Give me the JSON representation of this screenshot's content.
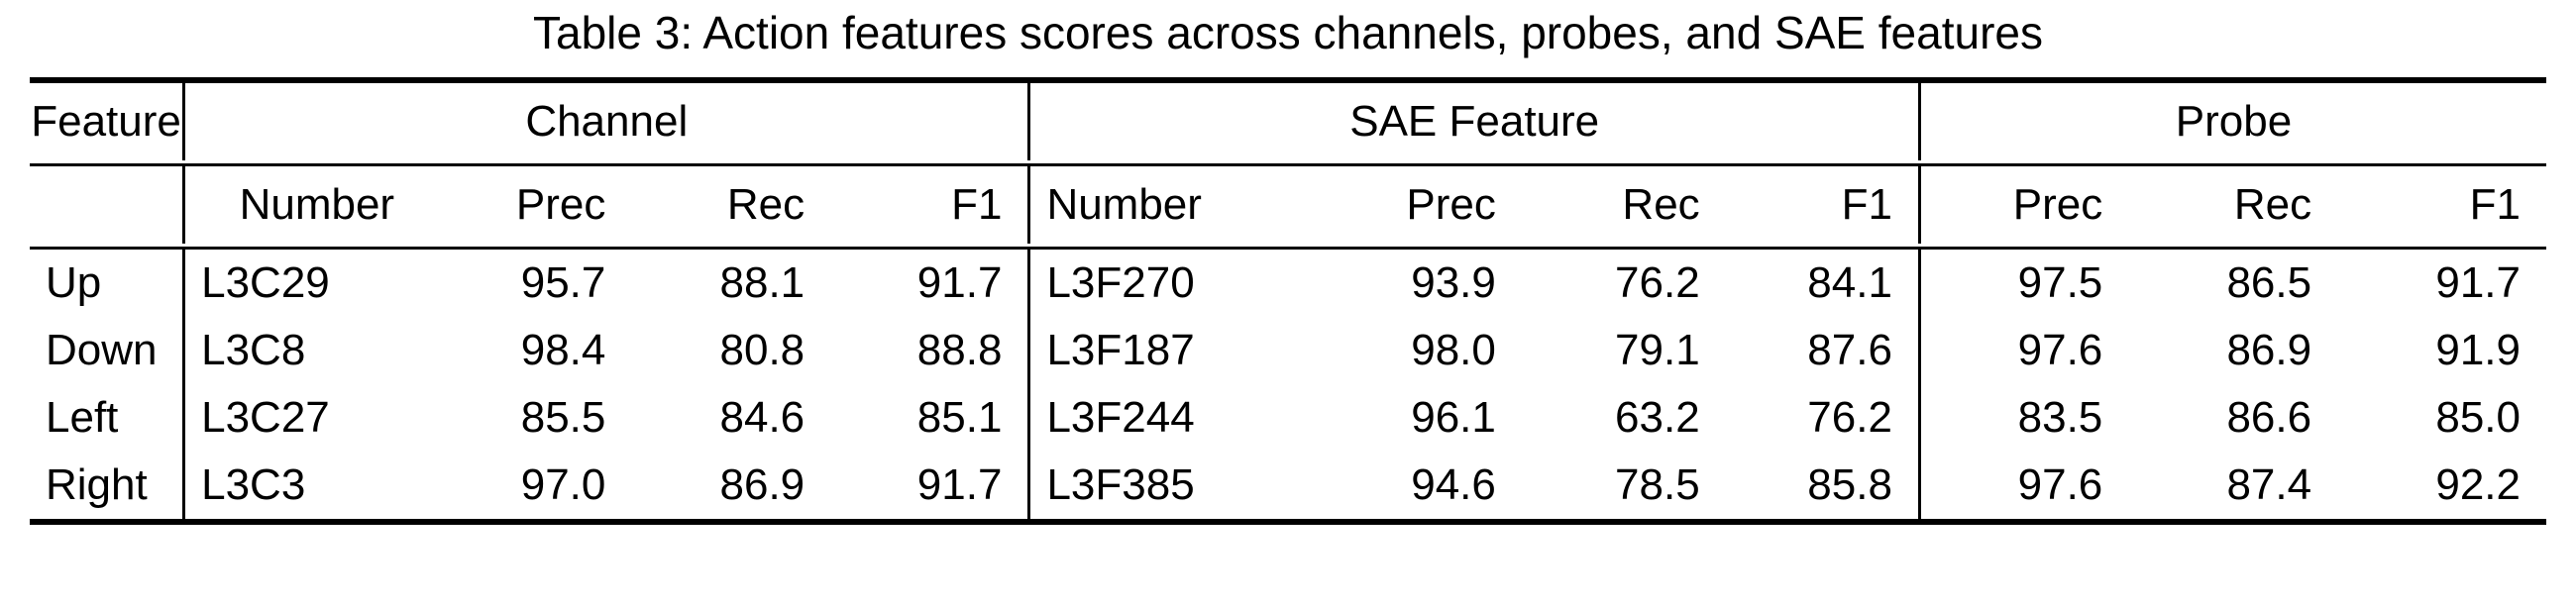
{
  "caption": "Table 3: Action features scores across channels, probes, and SAE features",
  "group_headers": {
    "feature": "Feature",
    "channel": "Channel",
    "sae_feature": "SAE Feature",
    "probe": "Probe"
  },
  "sub_headers": {
    "channel": [
      "Number",
      "Prec",
      "Rec",
      "F1"
    ],
    "sae": [
      "Number",
      "Prec",
      "Rec",
      "F1"
    ],
    "probe": [
      "Prec",
      "Rec",
      "F1"
    ]
  },
  "chart_data": {
    "type": "table",
    "title": "Table 3: Action features scores across channels, probes, and SAE features",
    "columns": [
      "Feature",
      "Channel Number",
      "Channel Prec",
      "Channel Rec",
      "Channel F1",
      "SAE Feature Number",
      "SAE Feature Prec",
      "SAE Feature Rec",
      "SAE Feature F1",
      "Probe Prec",
      "Probe Rec",
      "Probe F1"
    ],
    "categories": [
      "Up",
      "Down",
      "Left",
      "Right"
    ],
    "series": [
      {
        "name": "Channel Prec",
        "values": [
          95.7,
          98.4,
          85.5,
          97.0
        ]
      },
      {
        "name": "Channel Rec",
        "values": [
          88.1,
          80.8,
          84.6,
          86.9
        ]
      },
      {
        "name": "Channel F1",
        "values": [
          91.7,
          88.8,
          85.1,
          91.7
        ]
      },
      {
        "name": "SAE Feature Prec",
        "values": [
          93.9,
          98.0,
          96.1,
          94.6
        ]
      },
      {
        "name": "SAE Feature Rec",
        "values": [
          76.2,
          79.1,
          63.2,
          78.5
        ]
      },
      {
        "name": "SAE Feature F1",
        "values": [
          84.1,
          87.6,
          76.2,
          85.8
        ]
      },
      {
        "name": "Probe Prec",
        "values": [
          97.5,
          97.6,
          83.5,
          97.6
        ]
      },
      {
        "name": "Probe Rec",
        "values": [
          86.5,
          86.9,
          86.6,
          87.4
        ]
      },
      {
        "name": "Probe F1",
        "values": [
          91.7,
          91.9,
          85.0,
          92.2
        ]
      }
    ],
    "channel_numbers": [
      "L3C29",
      "L3C8",
      "L3C27",
      "L3C3"
    ],
    "sae_numbers": [
      "L3F270",
      "L3F187",
      "L3F244",
      "L3F385"
    ]
  },
  "rows": [
    {
      "feature": "Up",
      "ch_num": "L3C29",
      "ch_prec": "95.7",
      "ch_rec": "88.1",
      "ch_f1": "91.7",
      "ch_f1_bold": true,
      "sae_num": "L3F270",
      "sae_prec": "93.9",
      "sae_rec": "76.2",
      "sae_f1": "84.1",
      "sae_f1_bold": false,
      "pr_prec": "97.5",
      "pr_rec": "86.5",
      "pr_f1": "91.7",
      "pr_f1_bold": true
    },
    {
      "feature": "Down",
      "ch_num": "L3C8",
      "ch_prec": "98.4",
      "ch_rec": "80.8",
      "ch_f1": "88.8",
      "ch_f1_bold": false,
      "sae_num": "L3F187",
      "sae_prec": "98.0",
      "sae_rec": "79.1",
      "sae_f1": "87.6",
      "sae_f1_bold": false,
      "pr_prec": "97.6",
      "pr_rec": "86.9",
      "pr_f1": "91.9",
      "pr_f1_bold": true
    },
    {
      "feature": "Left",
      "ch_num": "L3C27",
      "ch_prec": "85.5",
      "ch_rec": "84.6",
      "ch_f1": "85.1",
      "ch_f1_bold": true,
      "sae_num": "L3F244",
      "sae_prec": "96.1",
      "sae_rec": "63.2",
      "sae_f1": "76.2",
      "sae_f1_bold": false,
      "pr_prec": "83.5",
      "pr_rec": "86.6",
      "pr_f1": "85.0",
      "pr_f1_bold": false
    },
    {
      "feature": "Right",
      "ch_num": "L3C3",
      "ch_prec": "97.0",
      "ch_rec": "86.9",
      "ch_f1": "91.7",
      "ch_f1_bold": false,
      "sae_num": "L3F385",
      "sae_prec": "94.6",
      "sae_rec": "78.5",
      "sae_f1": "85.8",
      "sae_f1_bold": false,
      "pr_prec": "97.6",
      "pr_rec": "87.4",
      "pr_f1": "92.2",
      "pr_f1_bold": true
    }
  ],
  "colors": {
    "text": "#000000",
    "background": "#ffffff",
    "rule": "#000000"
  }
}
